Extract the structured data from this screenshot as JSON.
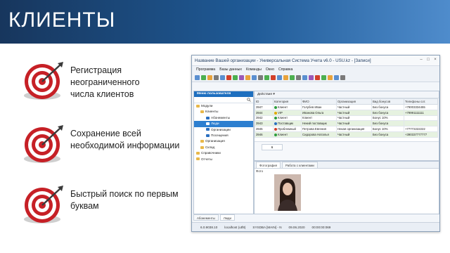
{
  "slide": {
    "title": "КЛИЕНТЫ"
  },
  "features": [
    {
      "text_line1": "Регистрация неограниченного",
      "text_line2": "числа клиентов"
    },
    {
      "text_line1": "Сохранение всей",
      "text_line2": "необходимой информации"
    },
    {
      "text_line1": "Быстрый поиск по первым",
      "text_line2": "буквам"
    }
  ],
  "app": {
    "title": "Название Вашей организации - Универсальная Система Учета v6.0 - USU.kz - [Записи]",
    "menu": [
      "Программа",
      "Базы данных",
      "Команды",
      "Окно",
      "Справка"
    ],
    "sidebar": {
      "header": "Меню пользователя",
      "items": [
        {
          "label": "Модули",
          "level": 0
        },
        {
          "label": "Клиенты",
          "level": 1
        },
        {
          "label": "Абонементы",
          "level": 2
        },
        {
          "label": "Люди",
          "level": 2,
          "selected": true
        },
        {
          "label": "Организации",
          "level": 2
        },
        {
          "label": "Посещения",
          "level": 2
        },
        {
          "label": "Организация",
          "level": 1
        },
        {
          "label": "Склад",
          "level": 1
        },
        {
          "label": "Справочники",
          "level": 0
        },
        {
          "label": "Отчеты",
          "level": 0
        }
      ]
    },
    "actions_label": "Действия",
    "table": {
      "columns": [
        "ID",
        "Категория",
        "ФИО",
        "Организация",
        "Вид бонусов",
        "Телефоны сот."
      ],
      "rows": [
        {
          "id": "3947",
          "category": "Клиент",
          "cat_color": "#2e9e3e",
          "name": "Голубев Иван",
          "org": "Частный",
          "bonus": "Без бонуса",
          "phone": "+79003334455",
          "bg": "#ffffff"
        },
        {
          "id": "3944",
          "category": "VIP",
          "cat_color": "#e0a800",
          "name": "Иванова Ольга",
          "org": "Частный",
          "bonus": "Без бонуса",
          "phone": "+79991111111",
          "bg": "#e6f2e0"
        },
        {
          "id": "3942",
          "category": "Клиент",
          "cat_color": "#2e9e3e",
          "name": "Клиент",
          "org": "Частный",
          "bonus": "Бонус 10%",
          "phone": "",
          "bg": "#ffffff"
        },
        {
          "id": "3943",
          "category": "Поставщик",
          "cat_color": "#2a6fc0",
          "name": "Некий поставщик",
          "org": "Частный",
          "bonus": "Без бонуса",
          "phone": "",
          "bg": "#e6f2e0"
        },
        {
          "id": "3945",
          "category": "Проблемный",
          "cat_color": "#d2402a",
          "name": "Петрова Евгения",
          "org": "Некая организация",
          "bonus": "Бонус 10%",
          "phone": "+77772222222",
          "bg": "#ffffff"
        },
        {
          "id": "3946",
          "category": "Клиент",
          "cat_color": "#2e9e3e",
          "name": "Сидорова Наталья",
          "org": "Частный",
          "bonus": "Без бонуса",
          "phone": "+390337777777",
          "bg": "#e6f2e0"
        }
      ],
      "row_count": "6"
    },
    "detail_tabs": [
      "Фотография",
      "Работа с клиентами"
    ],
    "photo_column": "Фото",
    "bottom_tabs": [
      "Абонементы",
      "Люди"
    ],
    "status": [
      "6.0.9038.10",
      "localhost (utf8)",
      "SYSDBA [MAIN] - N",
      "09.06.2020",
      "00:00:00:069"
    ]
  }
}
